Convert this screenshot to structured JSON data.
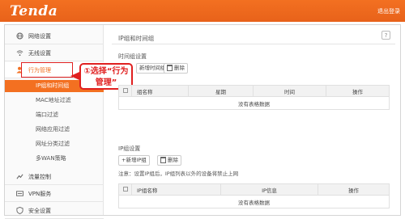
{
  "header": {
    "brand": "Tenda",
    "top_link": "退出登录"
  },
  "sidebar": {
    "items": [
      {
        "label": "网络设置",
        "icon": "globe-icon"
      },
      {
        "label": "无线设置",
        "icon": "wifi-icon"
      },
      {
        "label": "行为管理",
        "icon": "user-icon"
      },
      {
        "label": "流量控制",
        "icon": "traffic-icon"
      },
      {
        "label": "VPN服务",
        "icon": "vpn-icon"
      },
      {
        "label": "安全设置",
        "icon": "shield-icon"
      }
    ],
    "subitems": [
      "IP组和时间组",
      "MAC地址过滤",
      "端口过滤",
      "网络应用过滤",
      "网址分类过滤",
      "多WAN策略"
    ]
  },
  "callout": {
    "text": "①选择“行为管理”"
  },
  "page": {
    "title": "IP组和时间组",
    "help": "?"
  },
  "time_group": {
    "section_title": "时间组设置",
    "add_label": "新增时间组",
    "delete_label": "删除",
    "headers": [
      "组名称",
      "星期",
      "时间",
      "操作"
    ],
    "empty": "没有表格数据"
  },
  "ip_group": {
    "section_title": "IP组设置",
    "add_label": "+新增IP组",
    "delete_label": "删除",
    "note": "注意：设置IP组后，IP组列表以外的设备将禁止上网",
    "headers": [
      "IP组名称",
      "IP信息",
      "操作"
    ],
    "empty": "没有表格数据"
  }
}
